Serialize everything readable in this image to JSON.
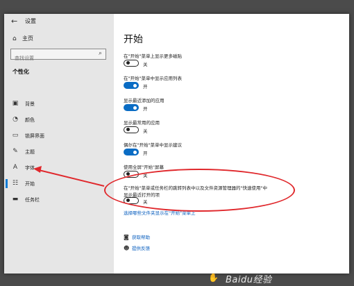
{
  "window": {
    "app_title": "设置",
    "controls": {
      "minimize": "—",
      "maximize": "☐",
      "close": "✕"
    }
  },
  "sidebar": {
    "home_label": "主页",
    "search_placeholder": "查找设置",
    "section_title": "个性化",
    "items": [
      {
        "label": "背景",
        "icon": "image-icon"
      },
      {
        "label": "颜色",
        "icon": "palette-icon"
      },
      {
        "label": "锁屏界面",
        "icon": "lock-screen-icon"
      },
      {
        "label": "主题",
        "icon": "brush-icon"
      },
      {
        "label": "字体",
        "icon": "font-icon"
      },
      {
        "label": "开始",
        "icon": "start-icon",
        "active": true
      },
      {
        "label": "任务栏",
        "icon": "taskbar-icon"
      }
    ]
  },
  "main": {
    "title": "开始",
    "settings": [
      {
        "label": "在\"开始\"菜单上显示更多磁贴",
        "state": "关",
        "on": false
      },
      {
        "label": "在\"开始\"菜单中显示应用列表",
        "state": "开",
        "on": true
      },
      {
        "label": "显示最近添加的应用",
        "state": "开",
        "on": true
      },
      {
        "label": "显示最常用的应用",
        "state": "关",
        "on": false
      },
      {
        "label": "偶尔在\"开始\"菜单中显示建议",
        "state": "开",
        "on": true
      },
      {
        "label": "使用全屏\"开始\"屏幕",
        "state": "关",
        "on": false
      },
      {
        "label": "在\"开始\"菜单或任务栏的跳转列表中以及文件资源管理器的\"快速使用\"中",
        "label2": "显示最近打开的项",
        "state": "关",
        "on": false
      }
    ],
    "choose_folders_link": "选择哪些文件夹显示在\"开始\"菜单上",
    "help": [
      {
        "label": "获取帮助",
        "icon": "help-icon"
      },
      {
        "label": "提供反馈",
        "icon": "feedback-icon"
      }
    ]
  },
  "annotation": {
    "color": "#e0282c"
  },
  "watermark": {
    "text": "Baidu经验"
  },
  "colors": {
    "accent": "#0a6cc4",
    "sidebar_bg": "#e6e6e6",
    "link": "#0a5fbf"
  }
}
